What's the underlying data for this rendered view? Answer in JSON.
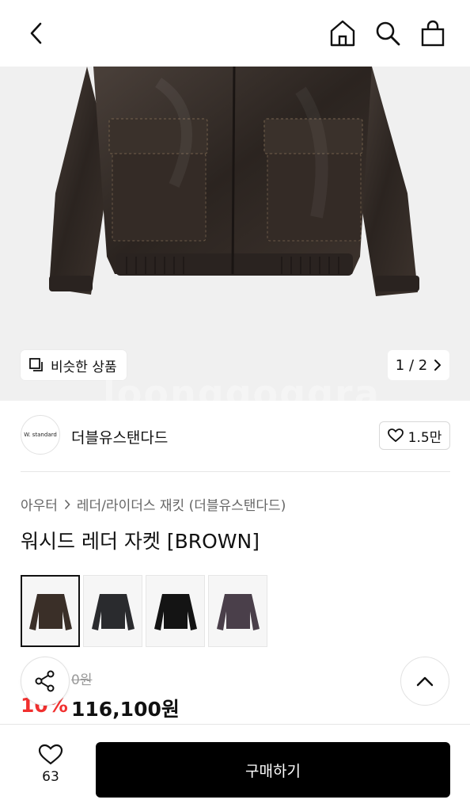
{
  "header": {
    "icons": [
      "chevron-left-icon",
      "home-icon",
      "search-icon",
      "shopping-bag-icon"
    ]
  },
  "hero": {
    "similar_label": "비슷한 상품",
    "pager": "1 / 2",
    "watermark": "loonggoggra"
  },
  "brand": {
    "logo_text": "W. standard",
    "name": "더블유스탠다드",
    "likes": "1.5만"
  },
  "product": {
    "breadcrumb": [
      "아우터",
      "레더/라이더스 재킷 (더블유스탠다드)"
    ],
    "title": "워시드 레더 자켓 [BROWN]",
    "original_price_partial": "0원",
    "discount": "10%",
    "sale_price": "116,100원"
  },
  "thumbnails": [
    {
      "name": "brown",
      "color": "#3a2f28",
      "selected": true
    },
    {
      "name": "dark-gray",
      "color": "#2a2b2e",
      "selected": false
    },
    {
      "name": "black",
      "color": "#141414",
      "selected": false
    },
    {
      "name": "purple",
      "color": "#4a3f4a",
      "selected": false
    }
  ],
  "bottom": {
    "wish_count": "63",
    "buy_label": "구매하기"
  },
  "colors": {
    "accent_red": "#f1302f",
    "buy_button": "#000000"
  }
}
